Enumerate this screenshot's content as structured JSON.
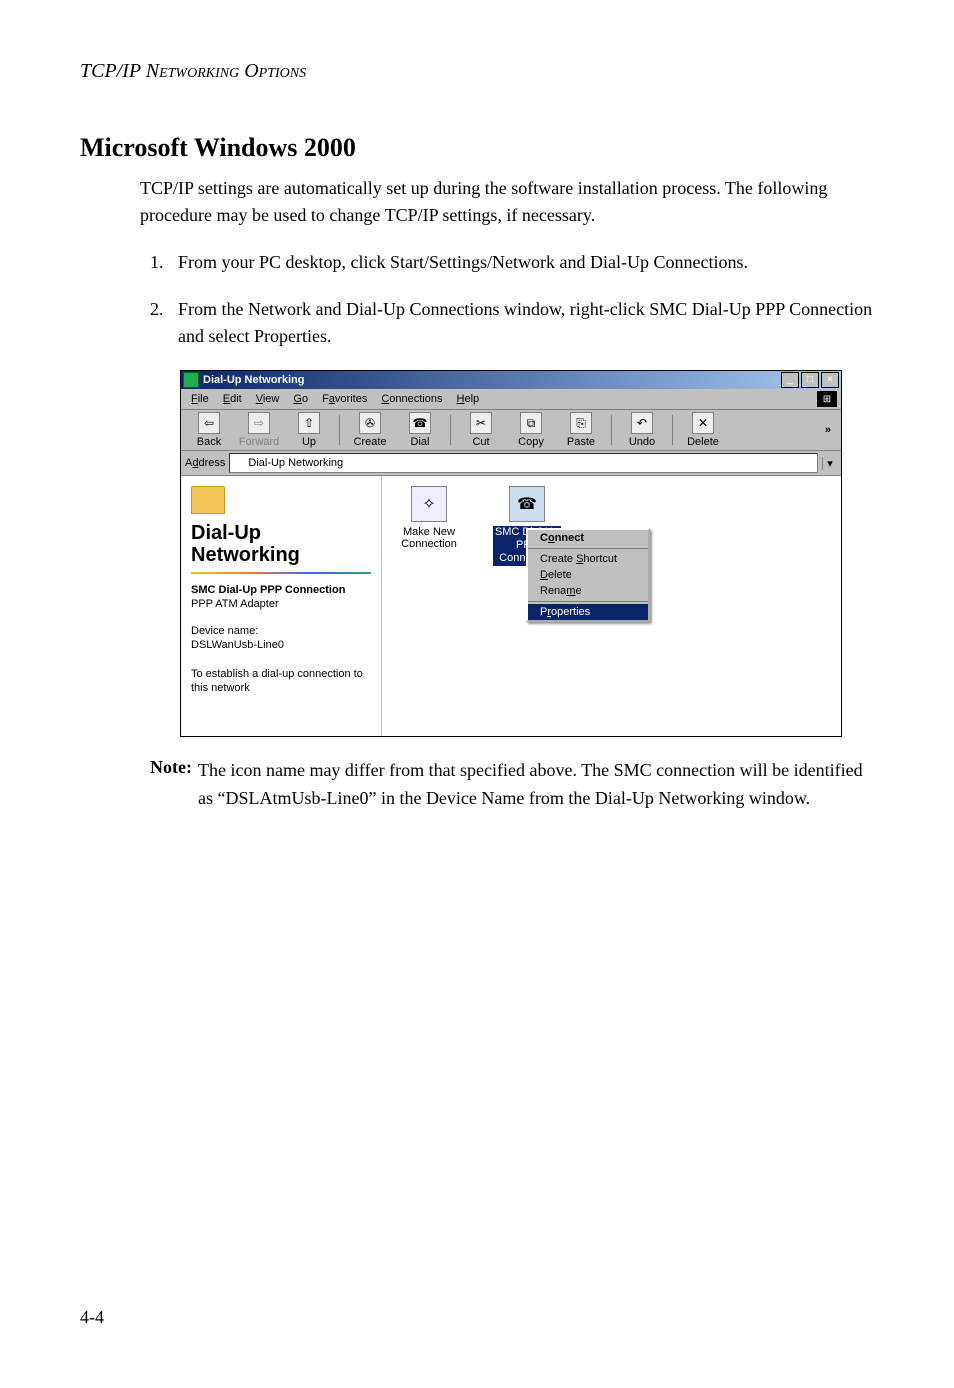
{
  "header": {
    "running": "TCP/IP Networking Options"
  },
  "page": {
    "section_title": "Microsoft Windows 2000",
    "intro": "TCP/IP settings are automatically set up during the software installation process. The following procedure may be used to change TCP/IP settings, if necessary.",
    "steps": [
      "From your PC desktop, click Start/Settings/Network and Dial-Up Connections.",
      "From the Network and Dial-Up Connections window, right-click SMC Dial-Up PPP Connection and select Properties."
    ],
    "note_label": "Note:",
    "note_text": "The icon name may differ from that specified above. The SMC connection will be identified as “DSLAtmUsb-Line0” in the Device Name from the Dial-Up Networking window.",
    "page_number": "4-4"
  },
  "window": {
    "title": "Dial-Up Networking",
    "title_buttons": {
      "min": "_",
      "max": "□",
      "close": "×"
    },
    "menu": [
      "File",
      "Edit",
      "View",
      "Go",
      "Favorites",
      "Connections",
      "Help"
    ],
    "toolbar": [
      {
        "label": "Back",
        "glyph": "⇦",
        "disabled": false
      },
      {
        "label": "Forward",
        "glyph": "⇨",
        "disabled": true
      },
      {
        "label": "Up",
        "glyph": "⇧",
        "disabled": false
      },
      {
        "label": "Create",
        "glyph": "✇",
        "disabled": false
      },
      {
        "label": "Dial",
        "glyph": "☎",
        "disabled": false
      },
      {
        "label": "Cut",
        "glyph": "✂",
        "disabled": false
      },
      {
        "label": "Copy",
        "glyph": "⧉",
        "disabled": false
      },
      {
        "label": "Paste",
        "glyph": "⎘",
        "disabled": false
      },
      {
        "label": "Undo",
        "glyph": "↶",
        "disabled": false
      },
      {
        "label": "Delete",
        "glyph": "✕",
        "disabled": false
      }
    ],
    "toolbar_more": "»",
    "addressbar": {
      "label": "Address",
      "value": "Dial-Up Networking",
      "drop": "▾"
    },
    "sidepane": {
      "title_line1": "Dial-Up",
      "title_line2": "Networking",
      "selected_name": "SMC Dial-Up PPP Connection",
      "selected_sub": "PPP ATM Adapter",
      "device_label": "Device name:",
      "device_value": "DSLWanUsb-Line0",
      "establish": "To establish a dial-up connection to this network"
    },
    "icons": [
      {
        "label": "Make New Connection",
        "selected": false
      },
      {
        "label_lines": [
          "SMC Dial-Up",
          "PPP",
          "Connection"
        ],
        "selected": true
      }
    ],
    "context_menu": [
      {
        "text": "Connect",
        "bold": true
      },
      {
        "sep": true
      },
      {
        "text": "Create Shortcut"
      },
      {
        "text": "Delete"
      },
      {
        "text": "Rename"
      },
      {
        "sep": true
      },
      {
        "text": "Properties",
        "selected": true
      }
    ]
  }
}
